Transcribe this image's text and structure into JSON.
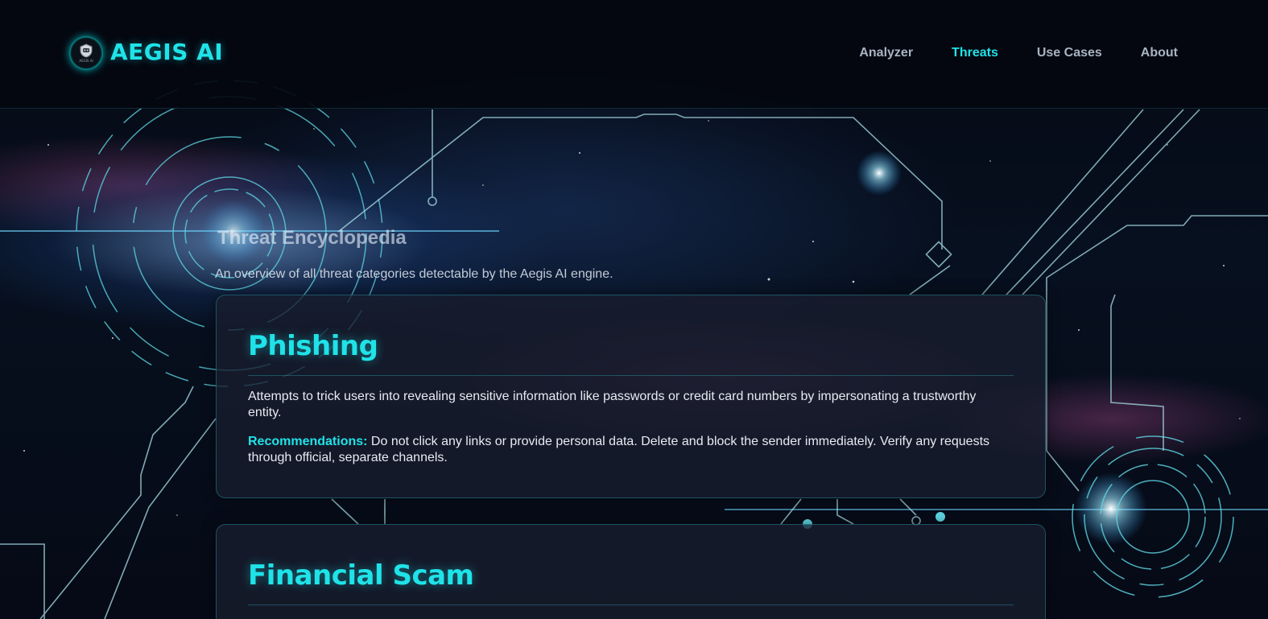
{
  "header": {
    "brand": "AEGIS AI",
    "logo_small_text": "AEGIS AI",
    "nav": [
      {
        "label": "Analyzer",
        "active": false
      },
      {
        "label": "Threats",
        "active": true
      },
      {
        "label": "Use Cases",
        "active": false
      },
      {
        "label": "About",
        "active": false
      }
    ]
  },
  "intro": {
    "title": "Threat Encyclopedia",
    "subtitle": "An overview of all threat categories detectable by the Aegis AI engine."
  },
  "threats": [
    {
      "name": "Phishing",
      "description": "Attempts to trick users into revealing sensitive information like passwords or credit card numbers by impersonating a trustworthy entity.",
      "recommendation_label": "Recommendations:",
      "recommendation": "Do not click any links or provide personal data. Delete and block the sender immediately. Verify any requests through official, separate channels."
    },
    {
      "name": "Financial Scam"
    }
  ],
  "colors": {
    "accent": "#1fe3e8",
    "nav_text": "#a9b4c2",
    "card_bg": "#181e2e",
    "page_bg": "#05070d"
  }
}
